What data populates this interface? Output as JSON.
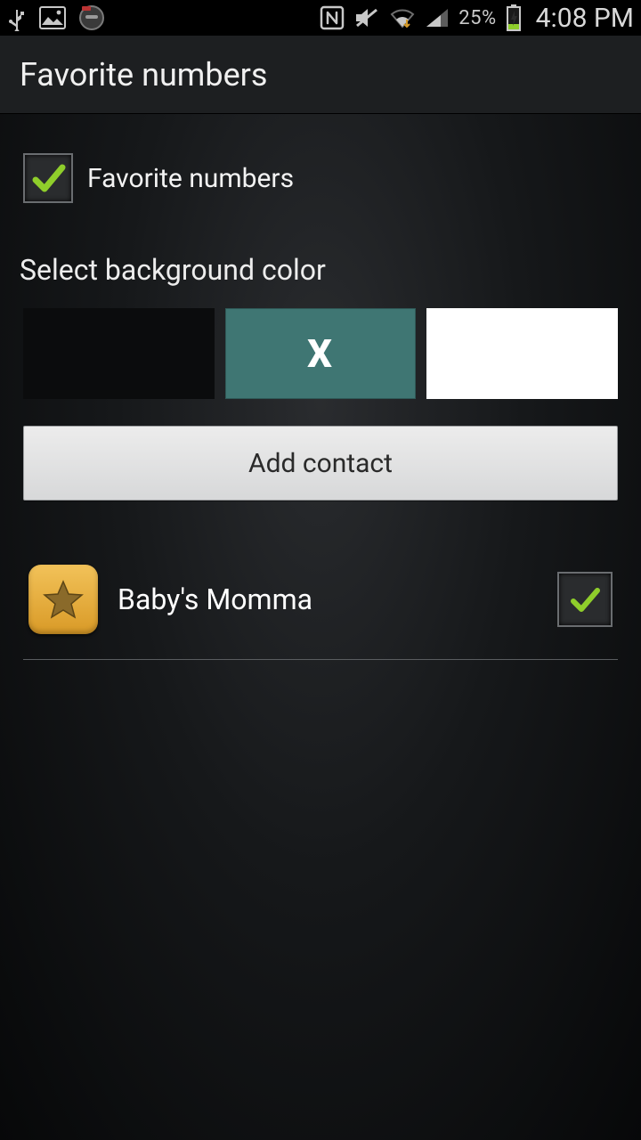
{
  "status": {
    "battery_percent": "25%",
    "time": "4:08 PM"
  },
  "header": {
    "title": "Favorite numbers"
  },
  "favorite_toggle": {
    "label": "Favorite numbers",
    "checked": true
  },
  "section": {
    "bg_label": "Select background color"
  },
  "swatches": {
    "colors": [
      "#0b0c0d",
      "#3f7673",
      "#ffffff"
    ],
    "selected_index": 1,
    "selected_mark": "X"
  },
  "buttons": {
    "add_contact": "Add contact"
  },
  "contacts": [
    {
      "name": "Baby's Momma",
      "checked": true
    }
  ]
}
